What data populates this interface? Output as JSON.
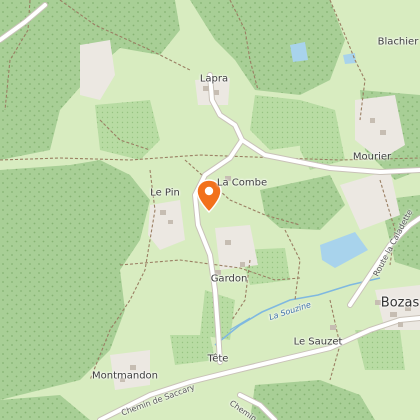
{
  "map": {
    "marker_icon": "map-pin-icon",
    "marker_color": "#f2711c",
    "colors": {
      "forest": "#a8cf96",
      "meadow": "#d8ecc0",
      "urban": "#ece8e2",
      "water": "#a8d3ec",
      "road": "#ffffff",
      "trail": "#9a7f63"
    },
    "places": {
      "lapra": "Lapra",
      "blachier": "Blachier",
      "mourier": "Mourier",
      "la_combe": "La Combe",
      "le_pin": "Le Pin",
      "gardon": "Gardon",
      "bozas": "Bozas",
      "le_sauzet": "Le Sauzet",
      "tete": "Tête",
      "montmandon": "Montmandon"
    },
    "water": {
      "la_souzine": "La Souzine"
    },
    "roads": {
      "route_caladette": "Route la Caladette",
      "saccary": "Chemin de Saccary",
      "chemin": "Chemin"
    }
  }
}
